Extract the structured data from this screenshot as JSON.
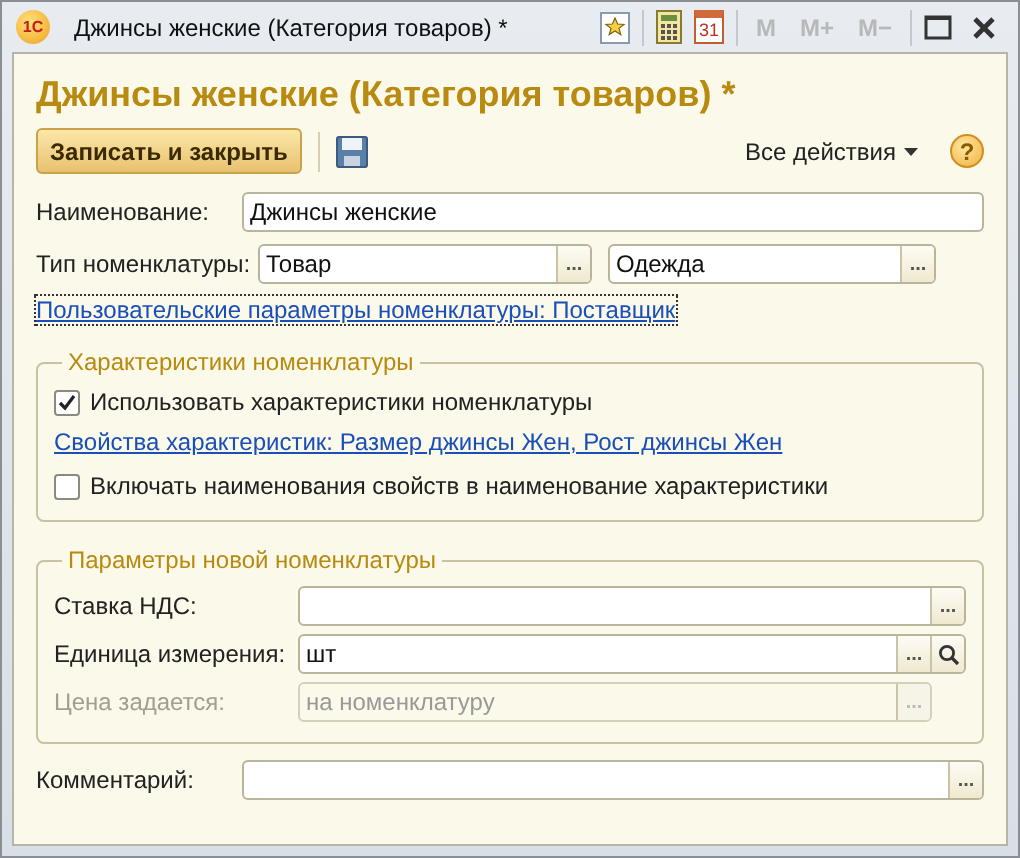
{
  "window": {
    "logo": "1С",
    "title": "Джинсы женские (Категория товаров) *",
    "calendar_day": "31",
    "memory_buttons": [
      "M",
      "M+",
      "M−"
    ]
  },
  "heading": "Джинсы женские (Категория товаров) *",
  "toolbar": {
    "primary_button": "Записать и закрыть",
    "all_actions": "Все действия",
    "help": "?"
  },
  "name_row": {
    "label": "Наименование:",
    "value": "Джинсы женские"
  },
  "type_row": {
    "label": "Тип номенклатуры:",
    "fields": [
      {
        "value": "Товар",
        "button": "..."
      },
      {
        "value": "Одежда",
        "button": "..."
      }
    ]
  },
  "custom_params_link": {
    "text": "Пользовательские параметры номенклатуры: Поставщик",
    "focused": true
  },
  "characteristics_group": {
    "title": "Характеристики номенклатуры",
    "items": [
      {
        "kind": "checkbox",
        "text": "Использовать характеристики номенклатуры",
        "checked": true
      },
      {
        "kind": "link",
        "text": "Свойства характеристик: Размер джинсы Жен, Рост джинсы Жен"
      },
      {
        "kind": "checkbox",
        "text": "Включать наименования свойств в наименование характеристики",
        "checked": false
      }
    ]
  },
  "new_item_group": {
    "title": "Параметры новой номенклатуры",
    "rows": [
      {
        "label": "Ставка НДС:",
        "disabled": false,
        "buttons": [
          {
            "kind": "choice",
            "label": "..."
          }
        ]
      },
      {
        "label": "Единица измерения:",
        "value": "шт",
        "disabled": false,
        "buttons": [
          {
            "kind": "choice",
            "label": "..."
          },
          {
            "kind": "search"
          }
        ]
      },
      {
        "label": "Цена задается:",
        "value": "на номенклатуру",
        "disabled": true,
        "buttons": [
          {
            "kind": "choice",
            "label": "..."
          }
        ]
      }
    ]
  },
  "comment_row": {
    "label": "Комментарий:",
    "button": "..."
  }
}
